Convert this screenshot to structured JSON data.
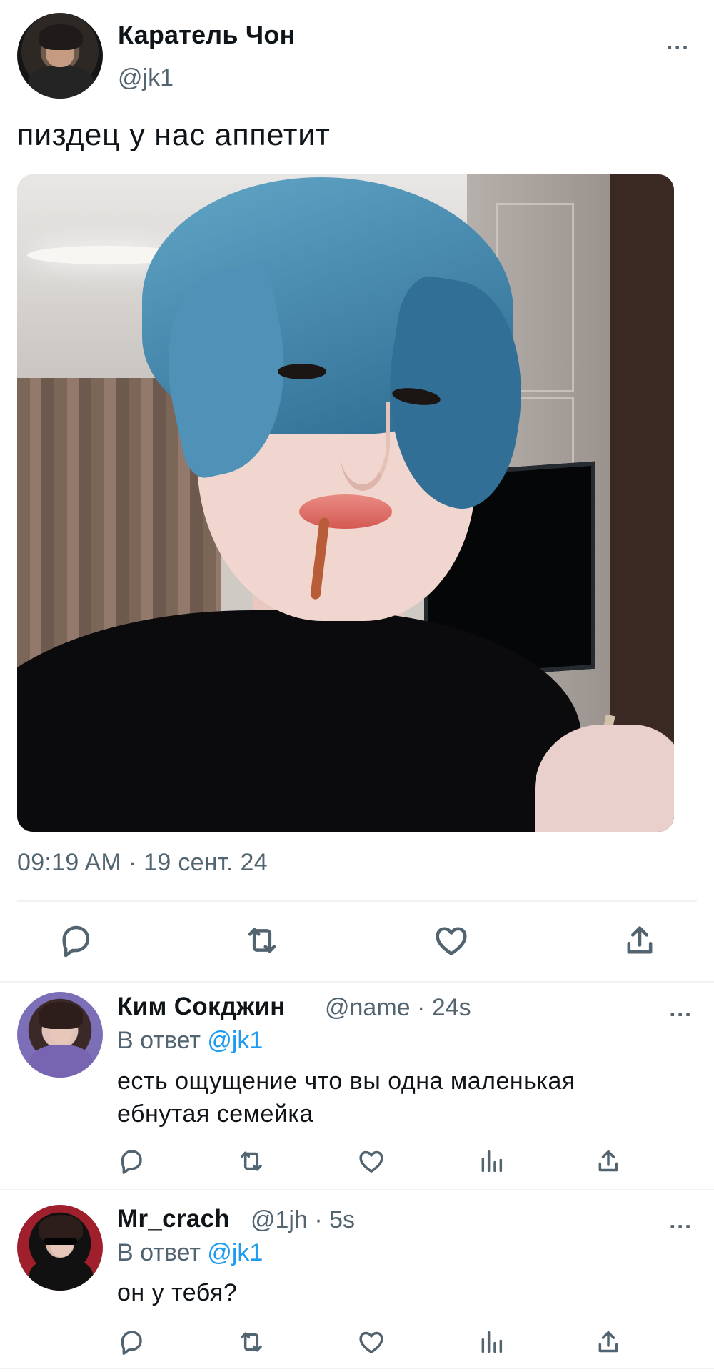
{
  "tweet": {
    "author_name": "Каратель Чон",
    "author_handle": "@jk1",
    "more": "...",
    "text": "пиздец у нас аппетит",
    "timestamp": "09:19 AM · 19 сент. 24",
    "actions": [
      "reply-icon",
      "retweet-icon",
      "like-icon",
      "share-icon"
    ]
  },
  "replies": [
    {
      "name": "Ким Сокджин",
      "meta": "@name · 24s",
      "reply_prefix": "В ответ ",
      "reply_mention": "@jk1",
      "text_line_1": "есть ощущение что вы одна маленькая",
      "text_line_2": "ебнутая семейка",
      "more": "...",
      "actions": [
        "reply-icon",
        "retweet-icon",
        "like-icon",
        "analytics-icon",
        "share-icon"
      ]
    },
    {
      "name": "Mr_crach",
      "meta": "@1jh · 5s",
      "reply_prefix": "В ответ ",
      "reply_mention": "@jk1",
      "text": "он у тебя?",
      "more": "...",
      "actions": [
        "reply-icon",
        "retweet-icon",
        "like-icon",
        "analytics-icon",
        "share-icon"
      ]
    }
  ],
  "colors": {
    "text": "#0f1419",
    "secondary": "#536471",
    "link": "#1d9bf0",
    "divider": "#eff3f4"
  }
}
